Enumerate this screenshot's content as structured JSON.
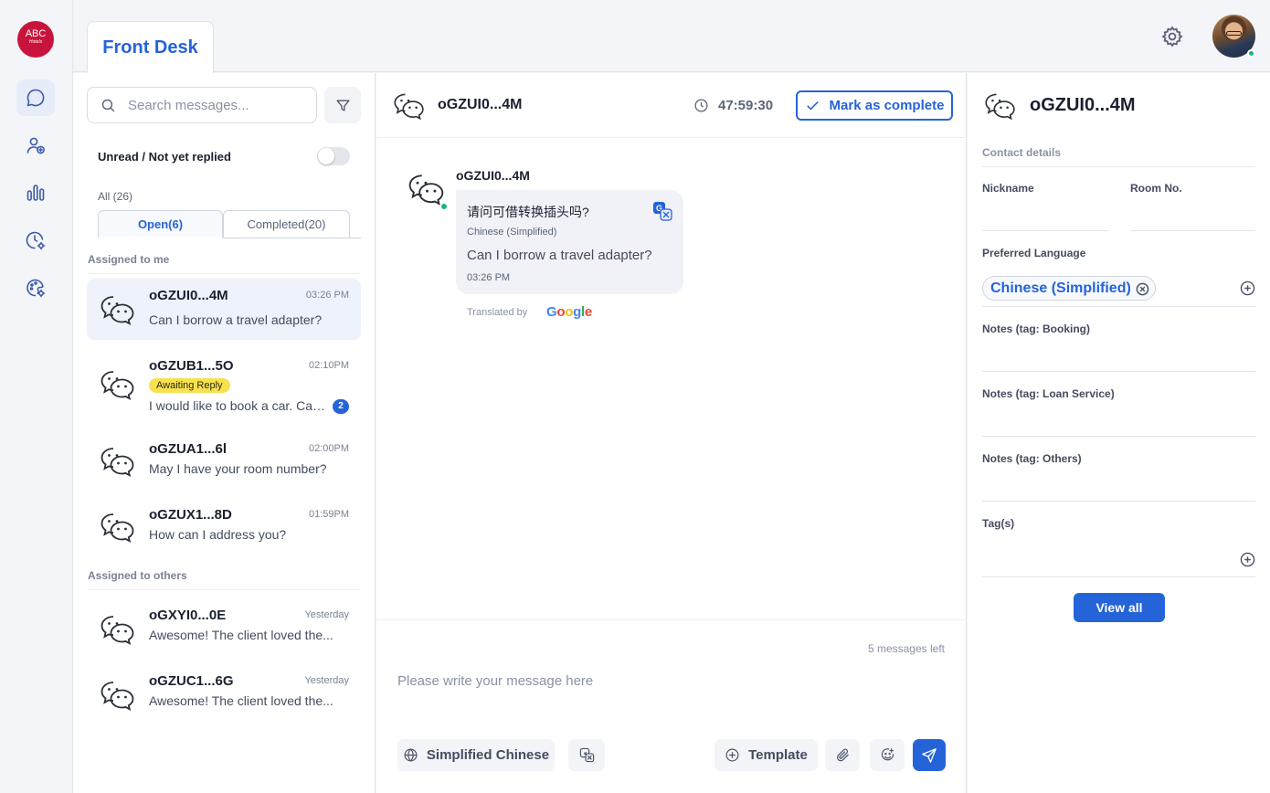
{
  "brand": {
    "logo_line1": "ABC",
    "logo_line2": "Hotels"
  },
  "nav": {
    "items": [
      {
        "icon": "chat-bubble-icon",
        "active": true
      },
      {
        "icon": "add-user-icon",
        "active": false
      },
      {
        "icon": "bar-chart-icon",
        "active": false
      },
      {
        "icon": "clock-settings-icon",
        "active": false
      },
      {
        "icon": "palette-settings-icon",
        "active": false
      }
    ]
  },
  "header": {
    "tab_label": "Front Desk"
  },
  "list": {
    "search_placeholder": "Search messages...",
    "unread_toggle_label": "Unread / Not yet replied",
    "all_count": "All (26)",
    "tab_open": "Open(6)",
    "tab_completed": "Completed(20)",
    "assigned_to_me": "Assigned to me",
    "assigned_to_others": "Assigned to others",
    "mine": [
      {
        "name": "oGZUI0...4M",
        "time": "03:26 PM",
        "snippet": "Can I borrow a travel adapter?"
      },
      {
        "name": "oGZUB1...5O",
        "time": "02:10PM",
        "badge": "Awaiting Reply",
        "snippet": "I would like to book a car. Can you help me?",
        "unread": "2"
      },
      {
        "name": "oGZUA1...6l",
        "time": "02:00PM",
        "snippet": "May I have your room number?"
      },
      {
        "name": "oGZUX1...8D",
        "time": "01:59PM",
        "snippet": "How can I address you?"
      }
    ],
    "others": [
      {
        "name": "oGXYI0...0E",
        "time": "Yesterday",
        "snippet": "Awesome! The client loved the..."
      },
      {
        "name": "oGZUC1...6G",
        "time": "Yesterday",
        "snippet": "Awesome! The client loved the..."
      }
    ]
  },
  "chat": {
    "title": "oGZUI0...4M",
    "timer": "47:59:30",
    "complete_label": "Mark as complete",
    "message": {
      "sender": "oGZUI0...4M",
      "original": "请问可借转换插头吗?",
      "language": "Chinese (Simplified)",
      "translation": "Can I borrow a travel adapter?",
      "time": "03:26 PM"
    },
    "translated_by": "Translated by",
    "google_letters": [
      {
        "ch": "G",
        "color": "#4285F4"
      },
      {
        "ch": "o",
        "color": "#EA4335"
      },
      {
        "ch": "o",
        "color": "#FBBC05"
      },
      {
        "ch": "g",
        "color": "#4285F4"
      },
      {
        "ch": "l",
        "color": "#34A853"
      },
      {
        "ch": "e",
        "color": "#EA4335"
      }
    ],
    "messages_left": "5 messages left",
    "compose_placeholder": "Please write your message here",
    "language_button": "Simplified Chinese",
    "template_button": "Template"
  },
  "contact": {
    "name": "oGZUI0...4M",
    "section_title": "Contact details",
    "nickname_label": "Nickname",
    "nickname_value": "",
    "room_label": "Room No.",
    "room_value": "",
    "preferred_language_label": "Preferred Language",
    "preferred_language_value": "Chinese (Simplified)",
    "notes_booking_label": "Notes (tag: Booking)",
    "notes_loan_label": "Notes (tag: Loan Service)",
    "notes_others_label": "Notes (tag: Others)",
    "tags_label": "Tag(s)",
    "view_all_label": "View all"
  },
  "colors": {
    "accent": "#2563d9",
    "badge_yellow": "#f7e14f",
    "online_green": "#18b67a",
    "brand_red": "#c8143c"
  }
}
